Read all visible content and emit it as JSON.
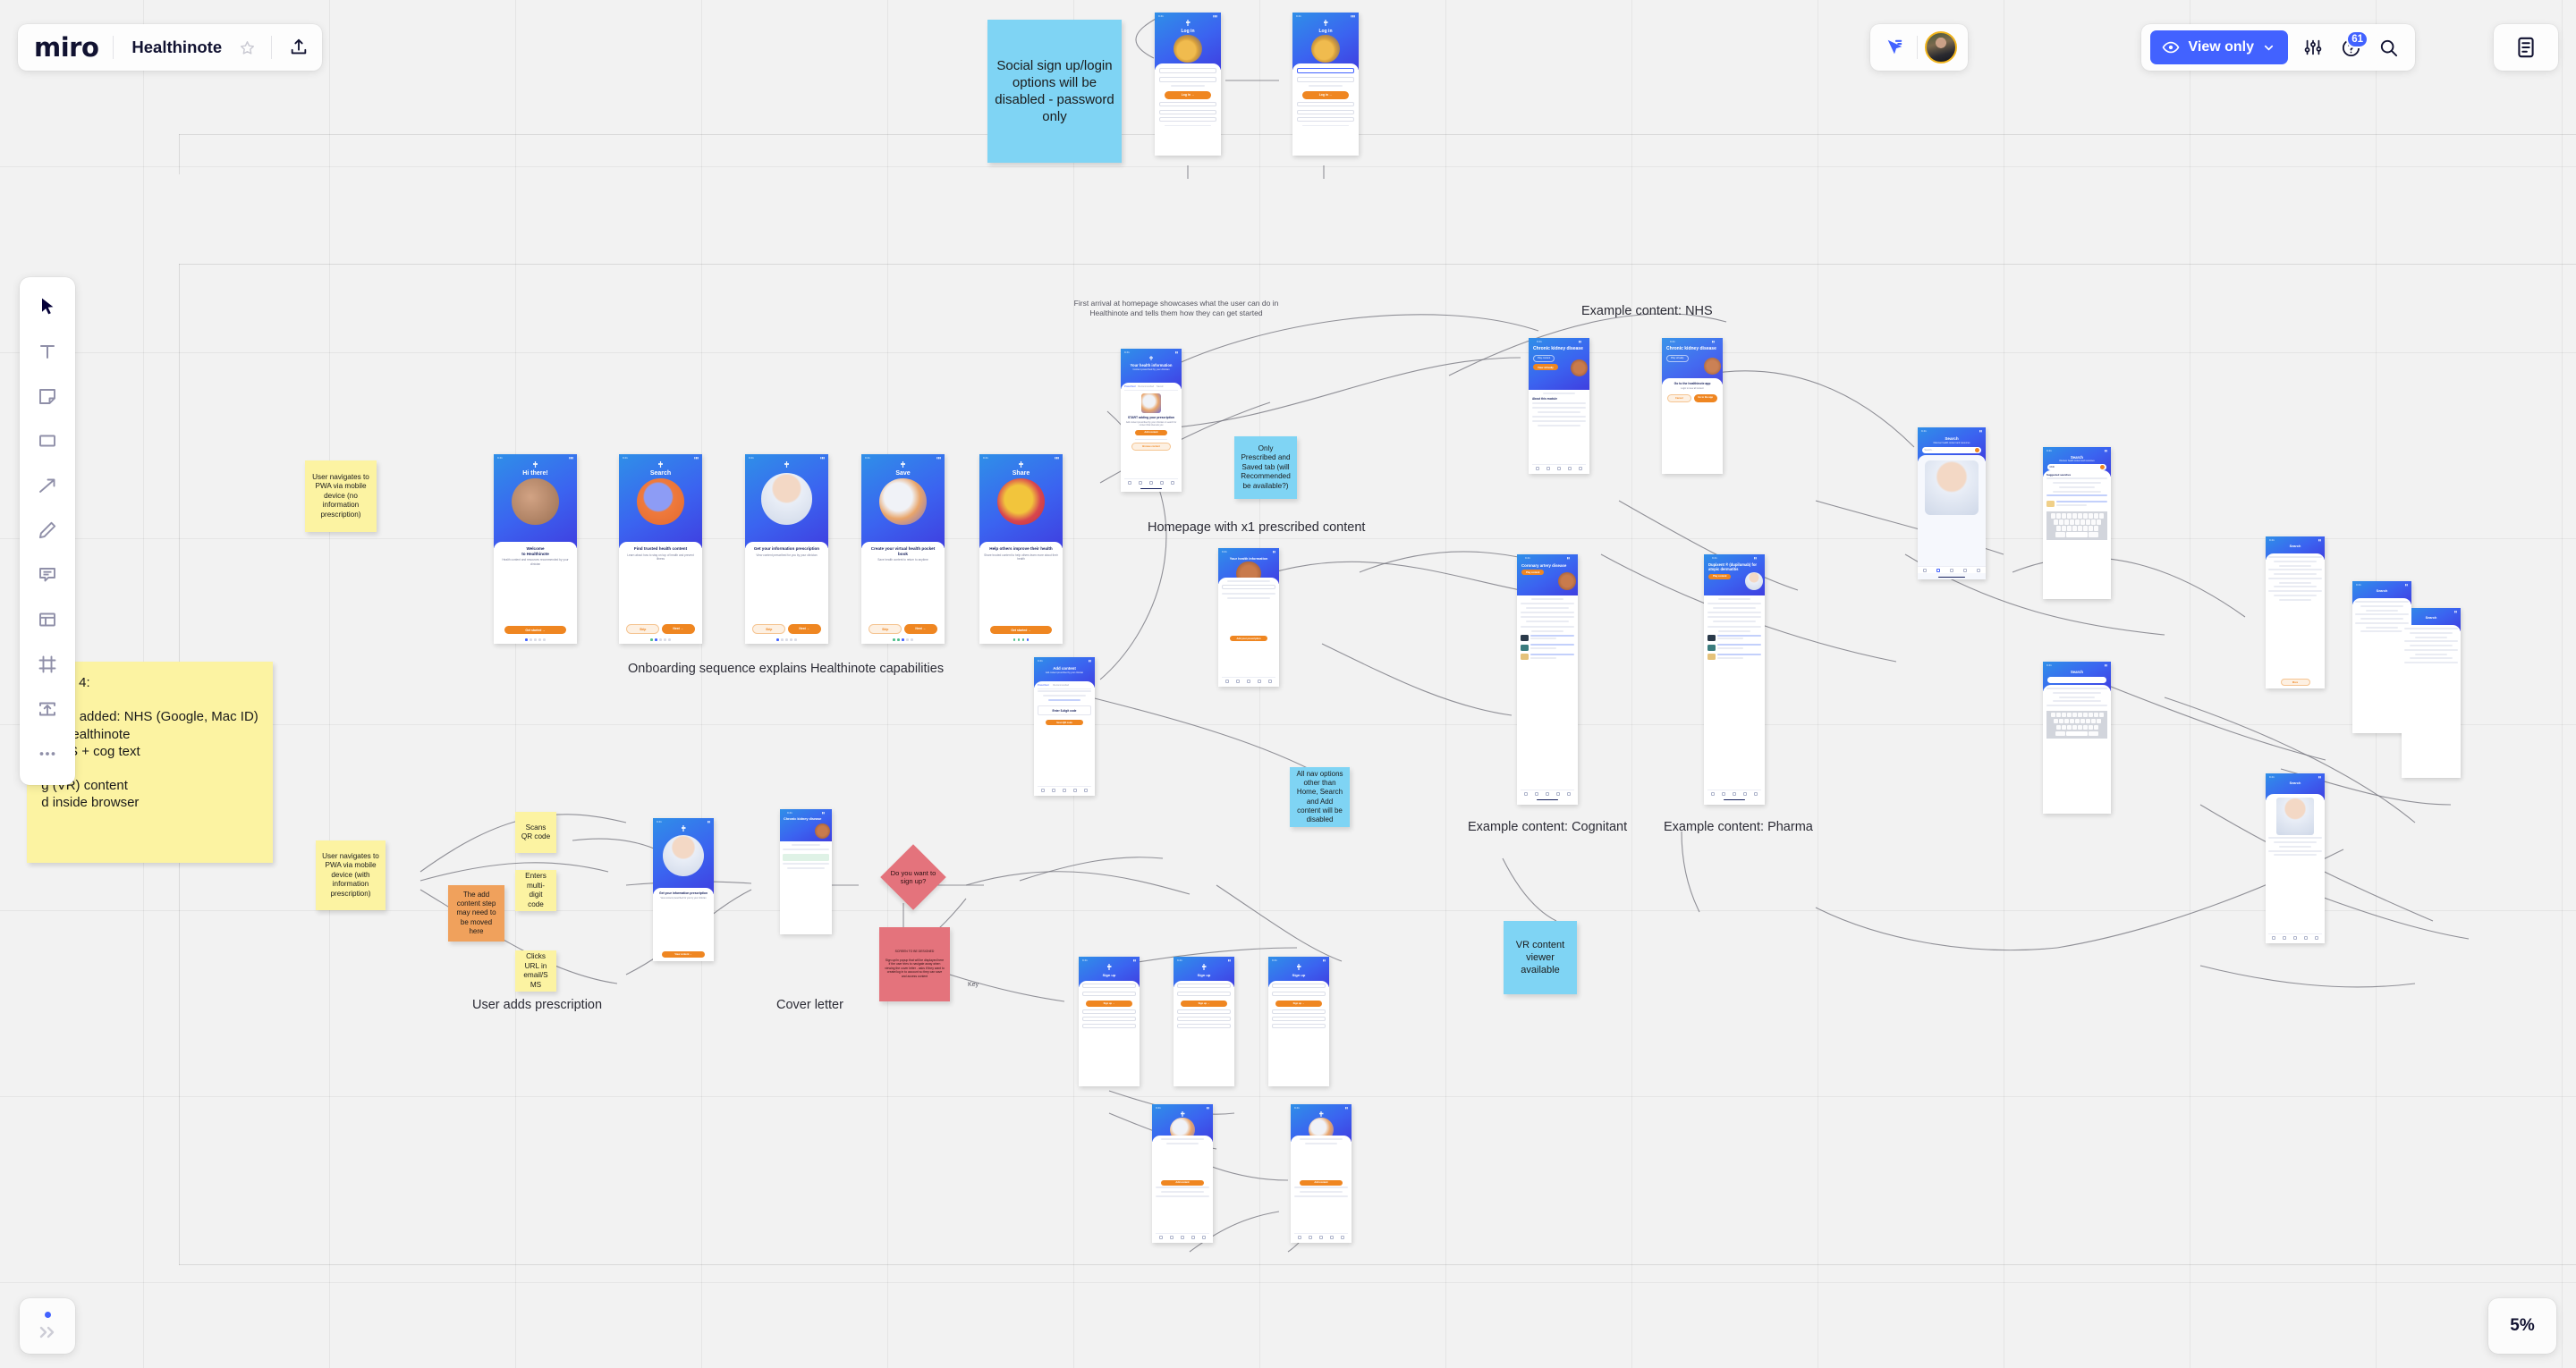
{
  "app": {
    "name": "miro",
    "board_title": "Healthinote",
    "zoom_level": "5%"
  },
  "header": {
    "logo_label": "miro",
    "star_label": "Favorite",
    "upload_label": "Upload",
    "cursor_label": "Cursor chat",
    "avatar_label": "Board owner",
    "view_mode": "View only",
    "settings_label": "Board settings",
    "help_label": "Help",
    "help_badge": "61",
    "search_label": "Search",
    "notes_label": "Notes panel"
  },
  "toolbar": {
    "items": [
      {
        "name": "select-tool",
        "label": "Select"
      },
      {
        "name": "text-tool",
        "label": "Text"
      },
      {
        "name": "sticky-tool",
        "label": "Sticky note"
      },
      {
        "name": "shape-tool",
        "label": "Shape"
      },
      {
        "name": "arrow-tool",
        "label": "Connection line"
      },
      {
        "name": "pen-tool",
        "label": "Pen"
      },
      {
        "name": "comment-tool",
        "label": "Comment"
      },
      {
        "name": "template-tool",
        "label": "Templates"
      },
      {
        "name": "frame-tool",
        "label": "Frame"
      },
      {
        "name": "upload-tool",
        "label": "Upload"
      },
      {
        "name": "more-tool",
        "label": "More tools"
      }
    ]
  },
  "footer": {
    "expand_label": "Expand",
    "zoom_label": "5%"
  },
  "board": {
    "sticky_notes": [
      {
        "id": "social-signup",
        "color": "blue",
        "text": "Social sign up/login options will be disabled - password only"
      },
      {
        "id": "wave4",
        "color": "yellow",
        "text": "Wave 4:\n\nsocial added: NHS (Google, Mac ID)\nl-to-healthinote\nr NHS + cog text\nviews\ng (VR) content\nd inside browser"
      },
      {
        "id": "pwa-no-presc",
        "color": "yellow",
        "text": "User navigates to PWA via mobile device (no information prescription)"
      },
      {
        "id": "pwa-with-presc",
        "color": "yellow",
        "text": "User navigates to PWA via mobile device (with information prescription)"
      },
      {
        "id": "add-content-step",
        "color": "orange",
        "text": "The add content step may need to be moved here"
      },
      {
        "id": "scans-qr",
        "color": "yellow",
        "text": "Scans QR code"
      },
      {
        "id": "enters-code",
        "color": "yellow",
        "text": "Enters multi-digit code"
      },
      {
        "id": "clicks-url",
        "color": "yellow",
        "text": "Clicks URL in email/SMS"
      },
      {
        "id": "prescribed-saved",
        "color": "blue",
        "text": "Only Prescribed and Saved tab (will Recommended be available?)"
      },
      {
        "id": "nav-disabled",
        "color": "blue",
        "text": "All nav options other than Home, Search and Add content will be disabled"
      },
      {
        "id": "vr-viewer",
        "color": "blue",
        "text": "VR content viewer available"
      },
      {
        "id": "signup-popup",
        "color": "red",
        "text": "SCREEN TO BE DESIGNED\n\nSign up/in popup that will be displayed here if the user tries to navigate away when viewing the cover letter - asks if they want to create/log in to account so they can save and access content"
      }
    ],
    "decisions": [
      {
        "id": "signup-decision",
        "text": "Do you want to sign up?"
      }
    ],
    "captions": [
      {
        "id": "onboarding",
        "text": "Onboarding sequence explains Healthinote capabilities"
      },
      {
        "id": "user-adds-presc",
        "text": "User adds prescription"
      },
      {
        "id": "cover-letter",
        "text": "Cover letter"
      },
      {
        "id": "homepage-x1",
        "text": "Homepage with x1 prescribed content"
      },
      {
        "id": "example-nhs",
        "text": "Example content: NHS"
      },
      {
        "id": "example-cognitant",
        "text": "Example content: Cognitant"
      },
      {
        "id": "example-pharma",
        "text": "Example content: Pharma"
      }
    ],
    "annotations": [
      {
        "id": "first-arrival",
        "text": "First arrival at homepage showcases what the user can do in Healthinote and tells them how they can get started"
      },
      {
        "id": "key-label",
        "text": "Key"
      }
    ],
    "screens": [
      {
        "id": "onb-1",
        "title": "Hi there!",
        "heading": "Welcome\nto Healthinote",
        "sub": "Health content and resources recommended by your clinician",
        "primary": "Get started →"
      },
      {
        "id": "onb-2",
        "title": "Search",
        "heading": "Find trusted health content",
        "sub": "Learn about how to stay on top of health and prevent illness",
        "primary": "Next →",
        "secondary": "Skip"
      },
      {
        "id": "onb-3",
        "title": "",
        "heading": "Get your information prescription",
        "sub": "View content prescribed for you by your clinician",
        "primary": "Next →",
        "secondary": "Skip"
      },
      {
        "id": "onb-4",
        "title": "Save",
        "heading": "Create your virtual health pocket book",
        "sub": "Save health content to return to anytime",
        "primary": "Next →",
        "secondary": "Skip"
      },
      {
        "id": "onb-5",
        "title": "Share",
        "heading": "Help others improve their health",
        "sub": "Share trusted content to help others learn more about their health",
        "primary": "Get started →"
      },
      {
        "id": "login-1",
        "title": "Log in",
        "heading": "",
        "sub": "",
        "primary": "Log in →",
        "fields": [
          "Email",
          "Password"
        ],
        "link": "Forgot your password?",
        "socials": [
          "Continue with Google",
          "Continue with Facebook",
          "Continue with NHS login"
        ],
        "footer": "Don't have an account? Sign up"
      },
      {
        "id": "login-2",
        "title": "Log in",
        "heading": "",
        "sub": "",
        "primary": "Log in →",
        "fields": [
          "tim@king",
          "Password"
        ],
        "link": "Forgot your password?",
        "socials": [
          "Continue with Google",
          "Continue with Facebook",
          "Continue with NHS login"
        ],
        "footer": "Don't have an account? Sign up"
      },
      {
        "id": "home-1",
        "title": "Your health information",
        "heading": "START adding your prescription",
        "sub": "Add content prescribed by your clinician or search for content that interests you",
        "primary": "Add content",
        "secondary": "Browse content"
      },
      {
        "id": "add-content",
        "title": "Add content",
        "heading": "Enter 5-digit code",
        "sub": "Add content prescribed by your clinician",
        "primary": "Scan QR code",
        "tabs": [
          "Prescribed",
          "Recommended"
        ]
      },
      {
        "id": "health-passport",
        "title": "Your health information",
        "heading": "Coronary artery disease",
        "sub": "Search health content",
        "primary": "Add your prescription"
      },
      {
        "id": "ckd-1",
        "title": "Chronic kidney disease",
        "heading": "About this module",
        "sub": "Sponsored by NHS",
        "primary": "View virtually",
        "secondary": "Play content"
      },
      {
        "id": "ckd-2",
        "title": "Chronic kidney disease",
        "heading": "Go to the healthinote app",
        "sub": "Login to view all content",
        "primary": "Go to the app",
        "secondary": "Cancel"
      },
      {
        "id": "coronary",
        "title": "Coronary artery disease",
        "heading": "",
        "sub": "",
        "primary": "Play content"
      },
      {
        "id": "dupixent",
        "title": "Dupixent ® (dupilumab) for atopic dermatitis",
        "heading": "",
        "sub": "",
        "primary": "Play content"
      },
      {
        "id": "search-1",
        "title": "Search",
        "heading": "",
        "sub": "Discover health content and resources",
        "placeholder": "Search..."
      },
      {
        "id": "search-2",
        "title": "Search",
        "heading": "Suggested searches",
        "sub": "Discover health content and resources",
        "placeholder": "CKD"
      },
      {
        "id": "get-presc",
        "title": "",
        "heading": "Get your information prescription",
        "sub": "View content prescribed for you by your clinician",
        "primary": "View content →"
      }
    ]
  }
}
